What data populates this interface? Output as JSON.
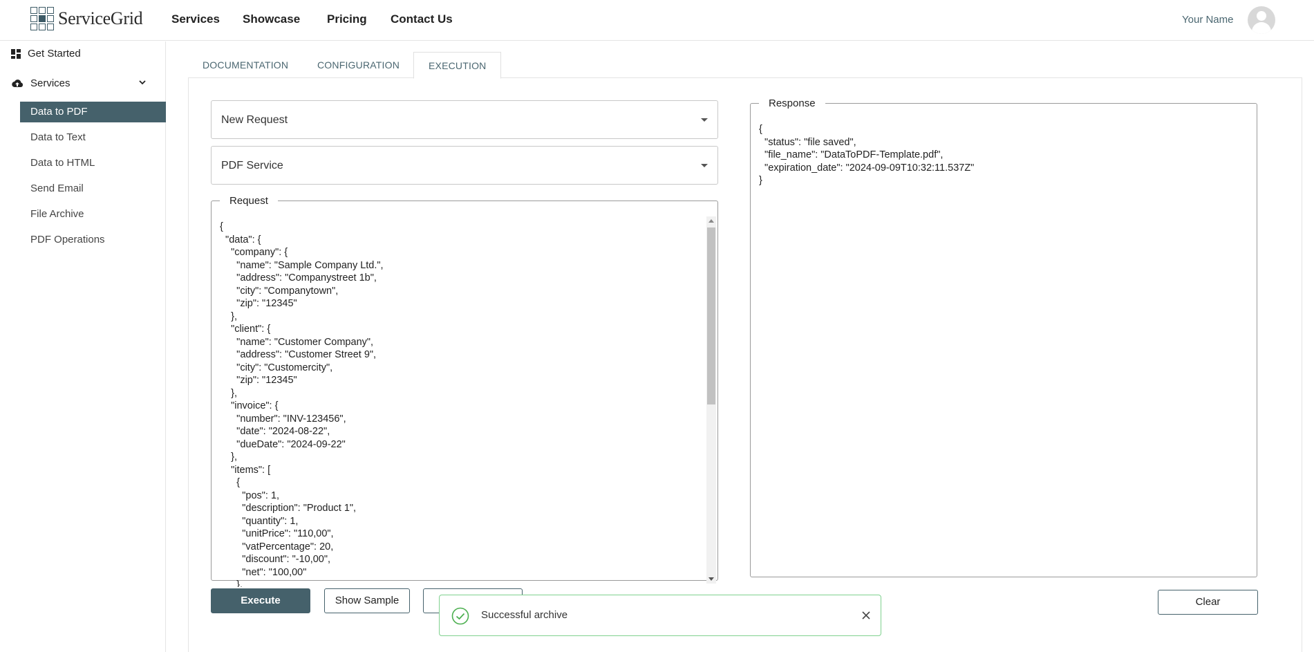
{
  "header": {
    "brand": "ServiceGrid",
    "nav": [
      "Services",
      "Showcase",
      "Pricing",
      "Contact Us"
    ],
    "user_name": "Your Name"
  },
  "sidebar": {
    "get_started": "Get Started",
    "services": "Services",
    "items": [
      {
        "label": "Data to PDF",
        "active": true
      },
      {
        "label": "Data to Text",
        "active": false
      },
      {
        "label": "Data to HTML",
        "active": false
      },
      {
        "label": "Send Email",
        "active": false
      },
      {
        "label": "File Archive",
        "active": false
      },
      {
        "label": "PDF Operations",
        "active": false
      }
    ]
  },
  "tabs": [
    {
      "label": "DOCUMENTATION",
      "active": false
    },
    {
      "label": "CONFIGURATION",
      "active": false
    },
    {
      "label": "EXECUTION",
      "active": true
    }
  ],
  "selects": {
    "request": "New Request",
    "service": "PDF Service"
  },
  "request": {
    "legend": "Request",
    "body": "{\n  \"data\": {\n    \"company\": {\n      \"name\": \"Sample Company Ltd.\",\n      \"address\": \"Companystreet 1b\",\n      \"city\": \"Companytown\",\n      \"zip\": \"12345\"\n    },\n    \"client\": {\n      \"name\": \"Customer Company\",\n      \"address\": \"Customer Street 9\",\n      \"city\": \"Customercity\",\n      \"zip\": \"12345\"\n    },\n    \"invoice\": {\n      \"number\": \"INV-123456\",\n      \"date\": \"2024-08-22\",\n      \"dueDate\": \"2024-09-22\"\n    },\n    \"items\": [\n      {\n        \"pos\": 1,\n        \"description\": \"Product 1\",\n        \"quantity\": 1,\n        \"unitPrice\": \"110,00\",\n        \"vatPercentage\": 20,\n        \"discount\": \"-10,00\",\n        \"net\": \"100,00\"\n      },"
  },
  "response": {
    "legend": "Response",
    "body": "{\n  \"status\": \"file saved\",\n  \"file_name\": \"DataToPDF-Template.pdf\",\n  \"expiration_date\": \"2024-09-09T10:32:11.537Z\"\n}"
  },
  "buttons": {
    "execute": "Execute",
    "show_sample": "Show Sample",
    "clear": "Clear"
  },
  "toast": {
    "message": "Successful archive"
  },
  "colors": {
    "accent": "#45616b",
    "toast_border": "#7fd18e",
    "success": "#4caf50"
  }
}
